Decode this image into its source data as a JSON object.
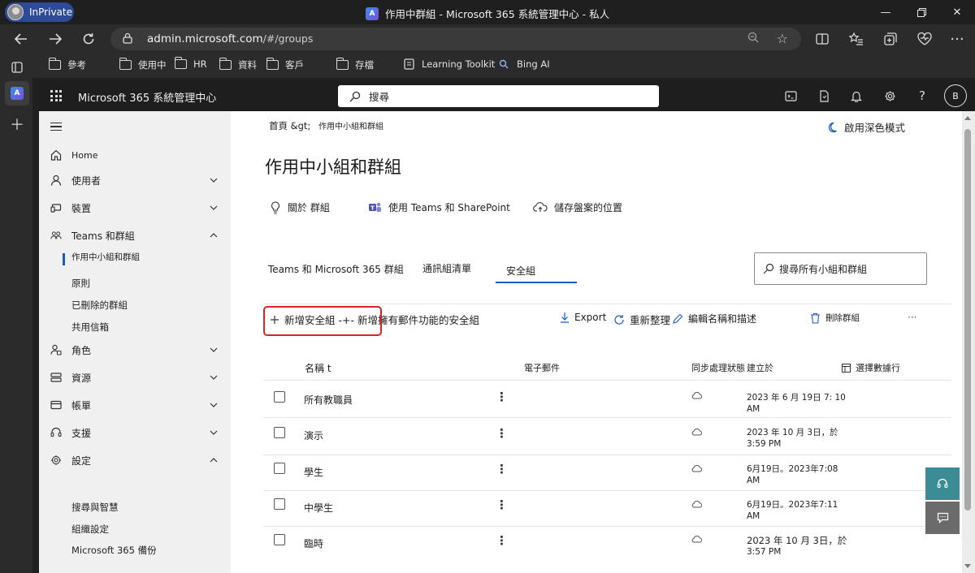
{
  "browser": {
    "inprivate_label": "InPrivate",
    "window_title": "作用中群組 - Microsoft 365 系統管理中心 - 私人",
    "url_host": "admin.microsoft.com",
    "url_path": "/#/groups"
  },
  "favorites": [
    {
      "label": "參考",
      "icon": "folder-icon"
    },
    {
      "label": "使用中",
      "icon": "folder-icon"
    },
    {
      "label": "HR",
      "icon": "folder-icon"
    },
    {
      "label": "資料",
      "icon": "folder-icon"
    },
    {
      "label": "客戶",
      "icon": "folder-icon"
    },
    {
      "label": "存檔",
      "icon": "folder-icon"
    },
    {
      "label": "Learning Toolkit",
      "icon": "page-icon"
    },
    {
      "label": "Bing AI",
      "icon": "search-icon"
    }
  ],
  "header": {
    "app_title": "Microsoft 365 系統管理中心",
    "search_placeholder": "搜尋",
    "user_initial": "B"
  },
  "nav": {
    "home": "Home",
    "users": "使用者",
    "devices": "裝置",
    "teams_groups": "Teams 和群組",
    "active_teams_groups": "作用中小組和群組",
    "policies": "原則",
    "deleted_groups": "已刪除的群組",
    "shared_mailboxes": "共用信箱",
    "roles": "角色",
    "resources": "資源",
    "billing": "帳單",
    "support": "支援",
    "settings": "設定",
    "search_intelligence": "搜尋與智慧",
    "org_settings": "組織設定",
    "m365_backup": "Microsoft 365 備份"
  },
  "page": {
    "breadcrumb_home": "首頁 &gt;",
    "breadcrumb_current": "作用中小組和群組",
    "dark_mode": "啟用深色模式",
    "title": "作用中小組和群組",
    "info_links": [
      "關於 群組",
      "使用 Teams 和 SharePoint",
      "儲存盤案的位置"
    ],
    "tabs": [
      "Teams 和 Microsoft 365 群組",
      "通訊組清單",
      "安全組"
    ],
    "active_tab": "安全組",
    "group_search": "搜尋所有小組和群組",
    "commands": {
      "add": "新增安全組 -+- 新增擁有郵件功能的安全組",
      "export": "Export",
      "refresh": "重新整理",
      "edit": "編輯名稱和描述",
      "delete": "刪除群組",
      "more": "···"
    },
    "columns": {
      "name": "名稱 t",
      "email": "電子郵件",
      "sync_status": "同步處理狀態",
      "created": "建立於",
      "choose_columns": "選擇數據行"
    },
    "rows": [
      {
        "name": "所有教職員",
        "created_line1": "2023 年 6 月 19日 7: 10",
        "created_line2": "AM"
      },
      {
        "name": "演示",
        "created_line1": "2023 年 10 月 3日，於",
        "created_line2": "3:59 PM"
      },
      {
        "name": "學生",
        "created_line1": "6月19日。2023年7:08",
        "created_line2": "AM"
      },
      {
        "name": "中學生",
        "created_line1": "6月19日。2023年7:11",
        "created_line2": "AM"
      },
      {
        "name": "臨時",
        "created_line1": "2023 年 10 月 3日，於",
        "created_line2": "3:57 PM"
      }
    ]
  },
  "colors": {
    "accent": "#1a5bc5",
    "highlight_outline": "#d8232a",
    "fab_teal": "#3c8c96",
    "fab_gray": "#6b6b6b"
  }
}
